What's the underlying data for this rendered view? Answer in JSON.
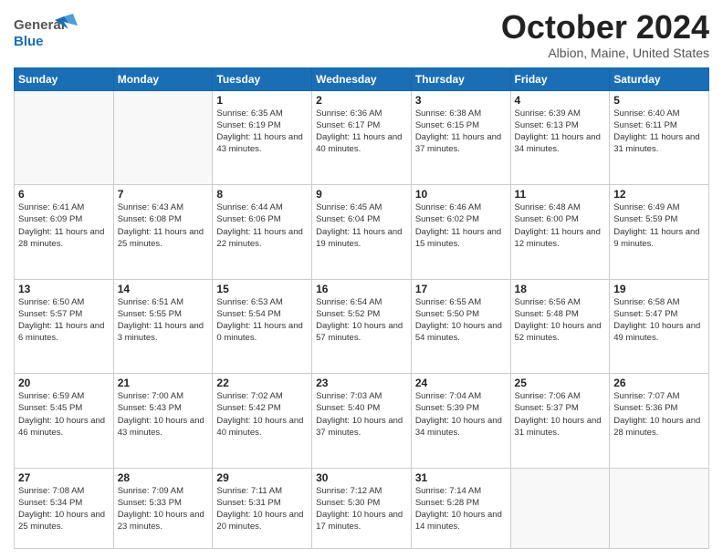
{
  "header": {
    "logo": {
      "general": "General",
      "blue": "Blue"
    },
    "title": "October 2024",
    "location": "Albion, Maine, United States"
  },
  "calendar": {
    "days_of_week": [
      "Sunday",
      "Monday",
      "Tuesday",
      "Wednesday",
      "Thursday",
      "Friday",
      "Saturday"
    ],
    "weeks": [
      [
        {
          "day": "",
          "info": ""
        },
        {
          "day": "",
          "info": ""
        },
        {
          "day": "1",
          "info": "Sunrise: 6:35 AM\nSunset: 6:19 PM\nDaylight: 11 hours\nand 43 minutes."
        },
        {
          "day": "2",
          "info": "Sunrise: 6:36 AM\nSunset: 6:17 PM\nDaylight: 11 hours\nand 40 minutes."
        },
        {
          "day": "3",
          "info": "Sunrise: 6:38 AM\nSunset: 6:15 PM\nDaylight: 11 hours\nand 37 minutes."
        },
        {
          "day": "4",
          "info": "Sunrise: 6:39 AM\nSunset: 6:13 PM\nDaylight: 11 hours\nand 34 minutes."
        },
        {
          "day": "5",
          "info": "Sunrise: 6:40 AM\nSunset: 6:11 PM\nDaylight: 11 hours\nand 31 minutes."
        }
      ],
      [
        {
          "day": "6",
          "info": "Sunrise: 6:41 AM\nSunset: 6:09 PM\nDaylight: 11 hours\nand 28 minutes."
        },
        {
          "day": "7",
          "info": "Sunrise: 6:43 AM\nSunset: 6:08 PM\nDaylight: 11 hours\nand 25 minutes."
        },
        {
          "day": "8",
          "info": "Sunrise: 6:44 AM\nSunset: 6:06 PM\nDaylight: 11 hours\nand 22 minutes."
        },
        {
          "day": "9",
          "info": "Sunrise: 6:45 AM\nSunset: 6:04 PM\nDaylight: 11 hours\nand 19 minutes."
        },
        {
          "day": "10",
          "info": "Sunrise: 6:46 AM\nSunset: 6:02 PM\nDaylight: 11 hours\nand 15 minutes."
        },
        {
          "day": "11",
          "info": "Sunrise: 6:48 AM\nSunset: 6:00 PM\nDaylight: 11 hours\nand 12 minutes."
        },
        {
          "day": "12",
          "info": "Sunrise: 6:49 AM\nSunset: 5:59 PM\nDaylight: 11 hours\nand 9 minutes."
        }
      ],
      [
        {
          "day": "13",
          "info": "Sunrise: 6:50 AM\nSunset: 5:57 PM\nDaylight: 11 hours\nand 6 minutes."
        },
        {
          "day": "14",
          "info": "Sunrise: 6:51 AM\nSunset: 5:55 PM\nDaylight: 11 hours\nand 3 minutes."
        },
        {
          "day": "15",
          "info": "Sunrise: 6:53 AM\nSunset: 5:54 PM\nDaylight: 11 hours\nand 0 minutes."
        },
        {
          "day": "16",
          "info": "Sunrise: 6:54 AM\nSunset: 5:52 PM\nDaylight: 10 hours\nand 57 minutes."
        },
        {
          "day": "17",
          "info": "Sunrise: 6:55 AM\nSunset: 5:50 PM\nDaylight: 10 hours\nand 54 minutes."
        },
        {
          "day": "18",
          "info": "Sunrise: 6:56 AM\nSunset: 5:48 PM\nDaylight: 10 hours\nand 52 minutes."
        },
        {
          "day": "19",
          "info": "Sunrise: 6:58 AM\nSunset: 5:47 PM\nDaylight: 10 hours\nand 49 minutes."
        }
      ],
      [
        {
          "day": "20",
          "info": "Sunrise: 6:59 AM\nSunset: 5:45 PM\nDaylight: 10 hours\nand 46 minutes."
        },
        {
          "day": "21",
          "info": "Sunrise: 7:00 AM\nSunset: 5:43 PM\nDaylight: 10 hours\nand 43 minutes."
        },
        {
          "day": "22",
          "info": "Sunrise: 7:02 AM\nSunset: 5:42 PM\nDaylight: 10 hours\nand 40 minutes."
        },
        {
          "day": "23",
          "info": "Sunrise: 7:03 AM\nSunset: 5:40 PM\nDaylight: 10 hours\nand 37 minutes."
        },
        {
          "day": "24",
          "info": "Sunrise: 7:04 AM\nSunset: 5:39 PM\nDaylight: 10 hours\nand 34 minutes."
        },
        {
          "day": "25",
          "info": "Sunrise: 7:06 AM\nSunset: 5:37 PM\nDaylight: 10 hours\nand 31 minutes."
        },
        {
          "day": "26",
          "info": "Sunrise: 7:07 AM\nSunset: 5:36 PM\nDaylight: 10 hours\nand 28 minutes."
        }
      ],
      [
        {
          "day": "27",
          "info": "Sunrise: 7:08 AM\nSunset: 5:34 PM\nDaylight: 10 hours\nand 25 minutes."
        },
        {
          "day": "28",
          "info": "Sunrise: 7:09 AM\nSunset: 5:33 PM\nDaylight: 10 hours\nand 23 minutes."
        },
        {
          "day": "29",
          "info": "Sunrise: 7:11 AM\nSunset: 5:31 PM\nDaylight: 10 hours\nand 20 minutes."
        },
        {
          "day": "30",
          "info": "Sunrise: 7:12 AM\nSunset: 5:30 PM\nDaylight: 10 hours\nand 17 minutes."
        },
        {
          "day": "31",
          "info": "Sunrise: 7:14 AM\nSunset: 5:28 PM\nDaylight: 10 hours\nand 14 minutes."
        },
        {
          "day": "",
          "info": ""
        },
        {
          "day": "",
          "info": ""
        }
      ]
    ]
  }
}
